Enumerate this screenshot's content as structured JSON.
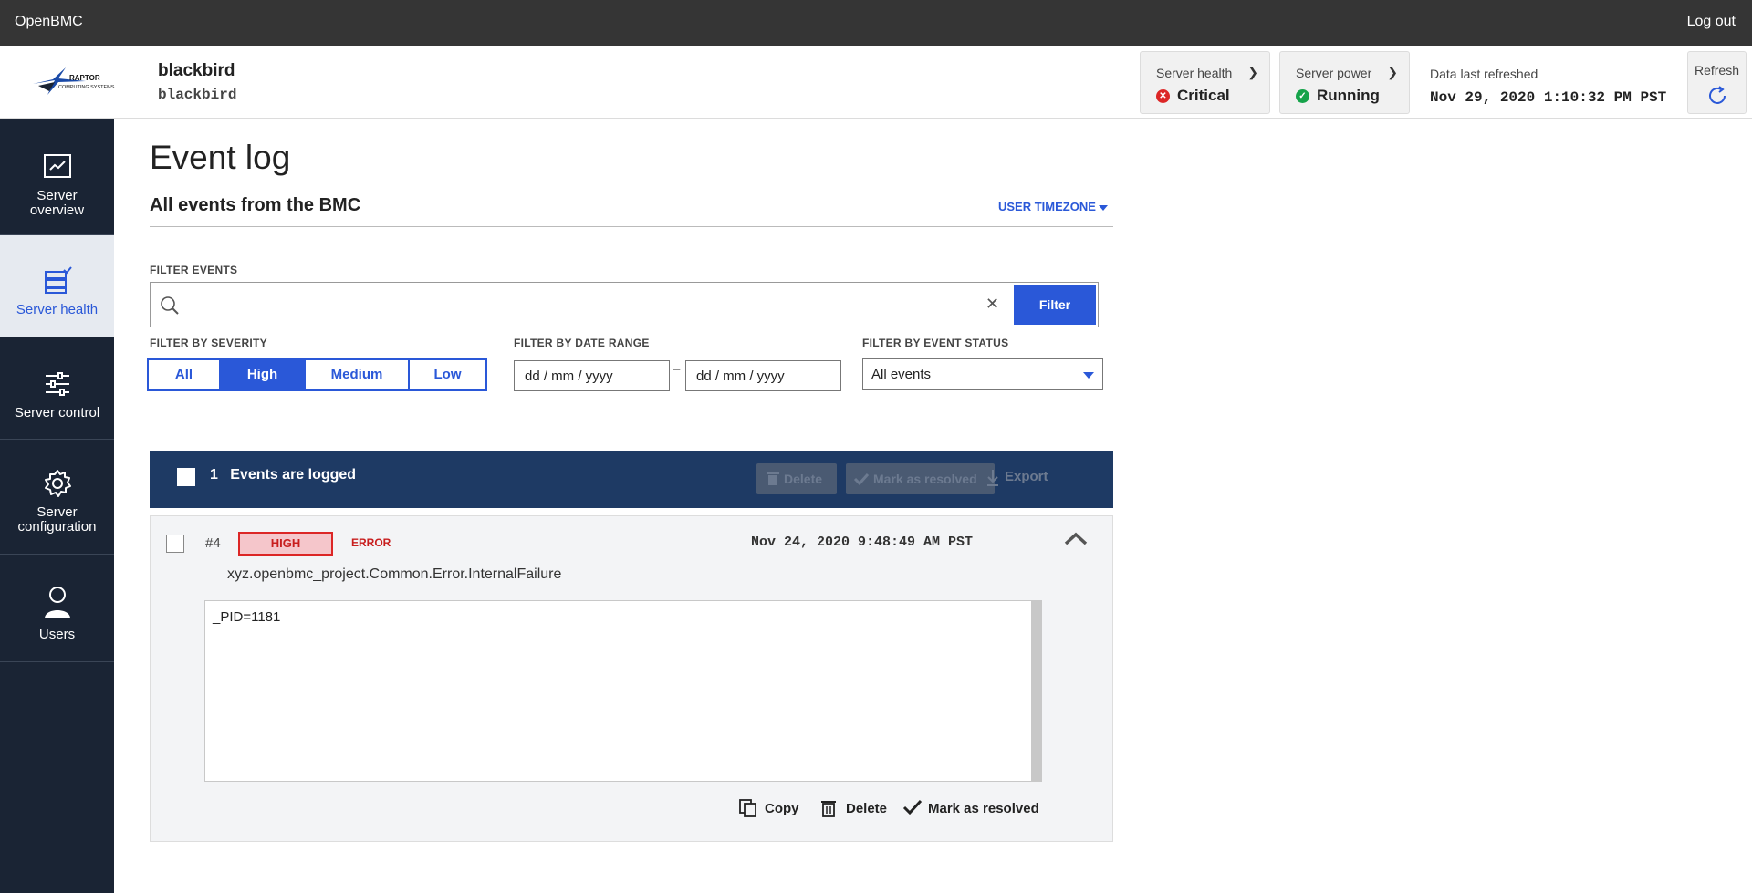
{
  "topbar": {
    "brand": "OpenBMC",
    "logout": "Log out"
  },
  "header": {
    "logo_text_1": "RAPTOR",
    "logo_text_2": "COMPUTING SYSTEMS",
    "host_name": "blackbird",
    "host_sub": "blackbird",
    "server_health": {
      "label": "Server health",
      "value": "Critical",
      "color": "#dc2626"
    },
    "server_power": {
      "label": "Server power",
      "value": "Running",
      "color": "#16a34a"
    },
    "refreshed_label": "Data last refreshed",
    "refreshed_value": "Nov 29, 2020 1:10:32 PM PST",
    "refresh_label": "Refresh"
  },
  "sidebar": {
    "items": [
      {
        "label_1": "Server",
        "label_2": "overview",
        "icon": "chart-icon"
      },
      {
        "label_1": "Server health",
        "label_2": "",
        "icon": "server-health-icon"
      },
      {
        "label_1": "Server control",
        "label_2": "",
        "icon": "sliders-icon"
      },
      {
        "label_1": "Server",
        "label_2": "configuration",
        "icon": "gear-icon"
      },
      {
        "label_1": "Users",
        "label_2": "",
        "icon": "user-icon"
      }
    ]
  },
  "main": {
    "page_title": "Event log",
    "section_title": "All events from the BMC",
    "timezone": "USER TIMEZONE",
    "filter_events_label": "FILTER EVENTS",
    "search_value": "",
    "filter_button": "Filter",
    "severity_label": "FILTER BY SEVERITY",
    "severity_options": [
      "All",
      "High",
      "Medium",
      "Low"
    ],
    "severity_selected": "High",
    "date_label": "FILTER BY DATE RANGE",
    "date_from": "dd / mm / yyyy",
    "date_to": "dd / mm / yyyy",
    "date_dash": "–",
    "status_label": "FILTER BY EVENT STATUS",
    "status_value": "All events"
  },
  "table": {
    "count": "1",
    "count_text": "Events are logged",
    "delete": "Delete",
    "mark_resolved": "Mark as resolved",
    "export": "Export"
  },
  "event": {
    "id": "#4",
    "severity": "HIGH",
    "type": "ERROR",
    "date": "Nov 24, 2020 9:48:49 AM PST",
    "message": "xyz.openbmc_project.Common.Error.InternalFailure",
    "detail": "_PID=1181",
    "copy": "Copy",
    "delete": "Delete",
    "mark_resolved": "Mark as resolved"
  },
  "colors": {
    "accent": "#2a58d8",
    "sidebar_bg": "#1a2434",
    "table_header": "#1e3a64",
    "critical": "#dc2626"
  }
}
